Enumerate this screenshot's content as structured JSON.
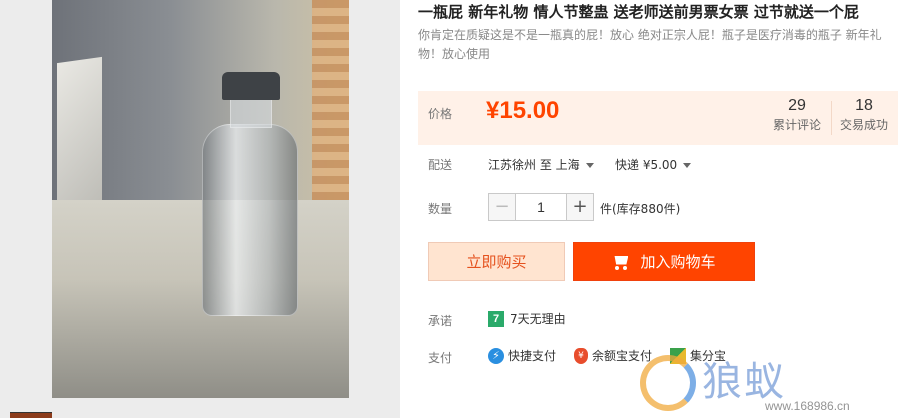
{
  "product": {
    "title": "一瓶屁 新年礼物 情人节整蛊 送老师送前男票女票 过节就送一个屁",
    "subtitle": "你肯定在质疑这是不是一瓶真的屁！放心 绝对正宗人屁！瓶子是医疗消毒的瓶子 新年礼物！放心使用"
  },
  "price": {
    "label": "价格",
    "value": "¥15.00",
    "reviews_count": "29",
    "reviews_label": "累计评论",
    "deals_count": "18",
    "deals_label": "交易成功"
  },
  "shipping": {
    "label": "配送",
    "route": "江苏徐州 至 上海",
    "fee": "快递 ¥5.00"
  },
  "quantity": {
    "label": "数量",
    "value": "1",
    "minus": "−",
    "plus": "+",
    "stock": "件(库存880件)"
  },
  "actions": {
    "buy_now": "立即购买",
    "add_to_cart": "加入购物车"
  },
  "promise": {
    "label": "承诺",
    "icon_text": "7",
    "text": "7天无理由"
  },
  "payment": {
    "label": "支付",
    "methods": [
      {
        "icon": "flash-icon",
        "label": "快捷支付"
      },
      {
        "icon": "bag-icon",
        "label": "余额宝支付"
      },
      {
        "icon": "tri-icon",
        "label": "集分宝"
      }
    ]
  },
  "watermark": {
    "text": "狼蚁",
    "url": "www.168986.cn"
  },
  "colors": {
    "accent": "#ff4400",
    "price_bg": "#fff1e8",
    "buy_now_bg": "#ffe4d0"
  }
}
